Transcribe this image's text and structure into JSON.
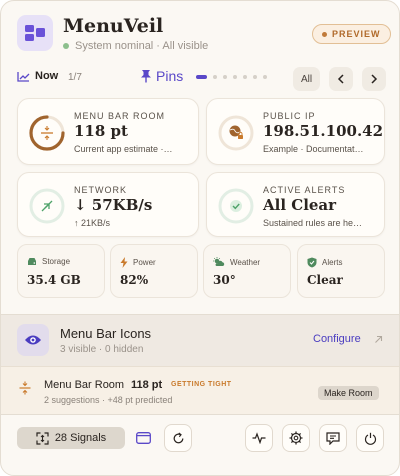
{
  "header": {
    "app_name": "MenuVeil",
    "status": "System nominal · All visible",
    "preview_badge": "PREVIEW"
  },
  "nav": {
    "now_label": "Now",
    "page_indicator": "1/7",
    "pins_label": "Pins",
    "all_label": "All",
    "page_count": 7,
    "active_page": 1
  },
  "cards": {
    "menu_bar_room": {
      "label": "MENU BAR ROOM",
      "value": "118 pt",
      "sub": "Current app estimate ·…"
    },
    "public_ip": {
      "label": "PUBLIC IP",
      "value": "198.51.100.42",
      "sub": "Example · Documentat…"
    },
    "network": {
      "label": "NETWORK",
      "value": "↓ 57KB/s",
      "sub": "↑ 21KB/s"
    },
    "active_alerts": {
      "label": "ACTIVE ALERTS",
      "value": "All Clear",
      "sub": "Sustained rules are he…"
    }
  },
  "mini_cards": {
    "storage": {
      "label": "Storage",
      "value": "35.4 GB"
    },
    "power": {
      "label": "Power",
      "value": "82%"
    },
    "weather": {
      "label": "Weather",
      "value": "30°"
    },
    "alerts": {
      "label": "Alerts",
      "value": "Clear"
    }
  },
  "menu_icons": {
    "title": "Menu Bar Icons",
    "subtitle": "3 visible · 0 hidden",
    "configure": "Configure"
  },
  "room": {
    "title": "Menu Bar Room",
    "value": "118 pt",
    "badge": "GETTING TIGHT",
    "subtitle": "2 suggestions · +48 pt predicted",
    "action": "Make Room"
  },
  "footer": {
    "signals": "28 Signals"
  },
  "colors": {
    "accent": "#5a48c8",
    "warning": "#c97a2c",
    "success": "#4fa36a",
    "background": "#fbf8f3"
  },
  "icons": [
    "app-grid-icon",
    "chart-icon",
    "pin-icon",
    "chevron-left-icon",
    "chevron-right-icon",
    "resize-icon",
    "globe-lock-icon",
    "network-arrows-icon",
    "check-icon",
    "disk-icon",
    "bolt-icon",
    "weather-icon",
    "shield-check-icon",
    "eye-icon",
    "external-link-icon",
    "expand-icon",
    "window-icon",
    "refresh-icon",
    "pulse-icon",
    "gear-icon",
    "message-icon",
    "power-icon"
  ]
}
